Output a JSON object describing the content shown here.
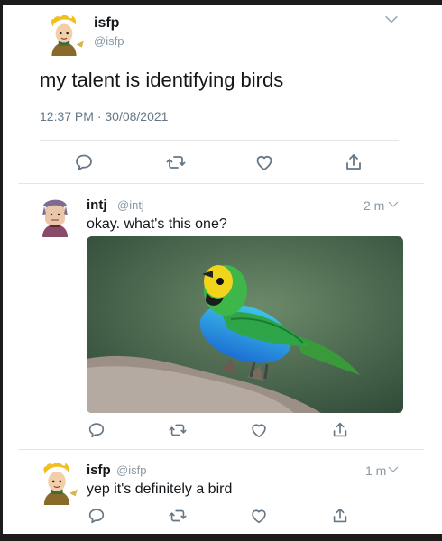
{
  "tweet_main": {
    "name": "isfp",
    "handle": "@isfp",
    "text": "my talent is identifying birds",
    "timestamp": "12:37 PM · 30/08/2021"
  },
  "reply1": {
    "name": "intj",
    "handle": "@intj",
    "time": "2 m",
    "text": "okay. what's this one?"
  },
  "reply2": {
    "name": "isfp",
    "handle": "@isfp",
    "time": "1 m",
    "text": "yep it's definitely a bird"
  },
  "icons": {
    "reply": "reply-icon",
    "retweet": "retweet-icon",
    "like": "heart-icon",
    "share": "share-icon",
    "menu": "chevron-down-icon"
  },
  "colors": {
    "text": "#14171a",
    "secondary": "#657786",
    "divider": "#e1e8ed"
  }
}
